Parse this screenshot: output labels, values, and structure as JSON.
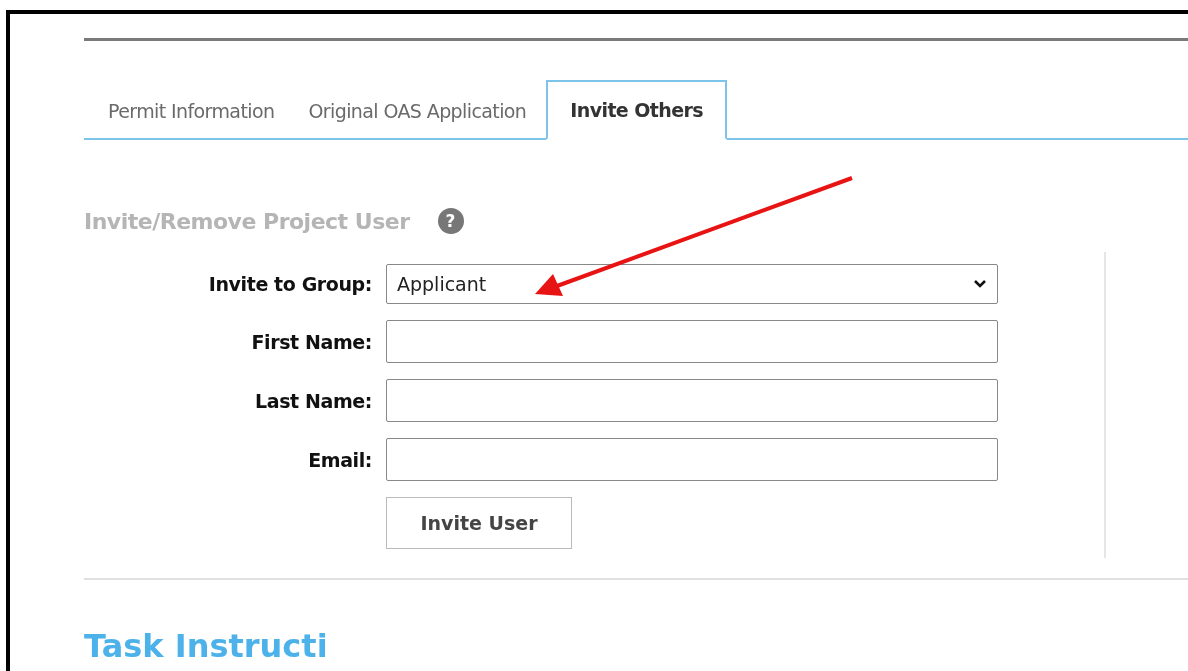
{
  "tabs": [
    {
      "label": "Permit Information",
      "selected": false
    },
    {
      "label": "Original OAS Application",
      "selected": false
    },
    {
      "label": "Invite Others",
      "selected": true
    }
  ],
  "section": {
    "title": "Invite/Remove Project User",
    "help_icon": "?"
  },
  "form": {
    "fields": [
      {
        "kind": "select",
        "label": "Invite to Group:",
        "value": "Applicant"
      },
      {
        "kind": "text",
        "label": "First Name:"
      },
      {
        "kind": "text",
        "label": "Last Name:"
      },
      {
        "kind": "text",
        "label": "Email:"
      }
    ],
    "submit": "Invite User"
  },
  "next_section": {
    "title": "Task Instructi"
  }
}
